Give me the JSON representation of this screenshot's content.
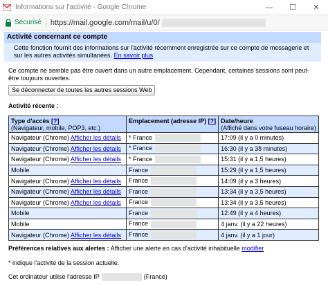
{
  "window": {
    "title": "Informations sur l'activité - Google Chrome",
    "minimize": "—",
    "maximize": "☐",
    "close": "✕"
  },
  "address": {
    "secure_label": "Sécurisé",
    "url": "https://mail.google.com/mail/u/0/"
  },
  "panel": {
    "title": "Activité concernant ce compte",
    "description": "Cette fonction fournit des informations sur l'activité récemment enregistrée sur ce compte de messagerie et sur les autres activités simultanées.",
    "more_link": "En savoir plus"
  },
  "notice": "Ce compte ne semble pas être ouvert dans un autre emplacement. Cependant, certaines sessions sont peut-être toujours ouvertes.",
  "signout_button": "Se déconnecter de toutes les autres sessions Web",
  "recent_title": "Activité récente :",
  "table": {
    "header_type": "Type d'accès [",
    "header_type_help": "?",
    "header_type_close": "]",
    "header_type_sub": "(Navigateur, mobile, POP3, etc.)",
    "header_ip": "Emplacement (adresse IP) [",
    "header_ip_help": "?",
    "header_ip_close": "]",
    "header_date": "Date/heure",
    "header_date_sub": "(Affiché dans votre fuseau horaire)",
    "rows": [
      {
        "type": "Navigateur (Chrome)",
        "link": "Afficher les détails",
        "location": "* France",
        "date": "17:09 (il y a 0 minutes)"
      },
      {
        "type": "Navigateur (Chrome)",
        "link": "Afficher les détails",
        "location": "* France",
        "date": "16:30 (il y a 38 minutes)"
      },
      {
        "type": "Navigateur (Chrome)",
        "link": "Afficher les détails",
        "location": "* France",
        "date": "15:31 (il y a 1,5 heures)"
      },
      {
        "type": "Mobile",
        "link": "",
        "location": "France",
        "date": "15:29 (il y a 1,5 heures)"
      },
      {
        "type": "Navigateur (Chrome)",
        "link": "Afficher les détails",
        "location": "France",
        "date": "14:09 (il y a 3 heures)"
      },
      {
        "type": "Navigateur (Chrome)",
        "link": "Afficher les détails",
        "location": "France",
        "date": "13:34 (il y a 3,5 heures)"
      },
      {
        "type": "Navigateur (Chrome)",
        "link": "Afficher les détails",
        "location": "France",
        "date": "13:34 (il y a 3,5 heures)"
      },
      {
        "type": "Mobile",
        "link": "",
        "location": "France",
        "date": "12:49 (il y a 4 heures)"
      },
      {
        "type": "Mobile",
        "link": "",
        "location": "France",
        "date": "4 janv. (il y a 22 heures)"
      },
      {
        "type": "Navigateur (Chrome)",
        "link": "Afficher les détails",
        "location": "France",
        "date": "4 janv. (il y a 1 jour)"
      }
    ]
  },
  "prefs": {
    "label": "Préférences relatives aux alertes :",
    "text": "Afficher une alerte en cas d'activité inhabituelle",
    "link": "modifier"
  },
  "footnote": "* indique l'activité de la session actuelle.",
  "ip_footer": {
    "prefix": "Cet ordinateur utilise l'adresse IP",
    "suffix": "(France)"
  }
}
